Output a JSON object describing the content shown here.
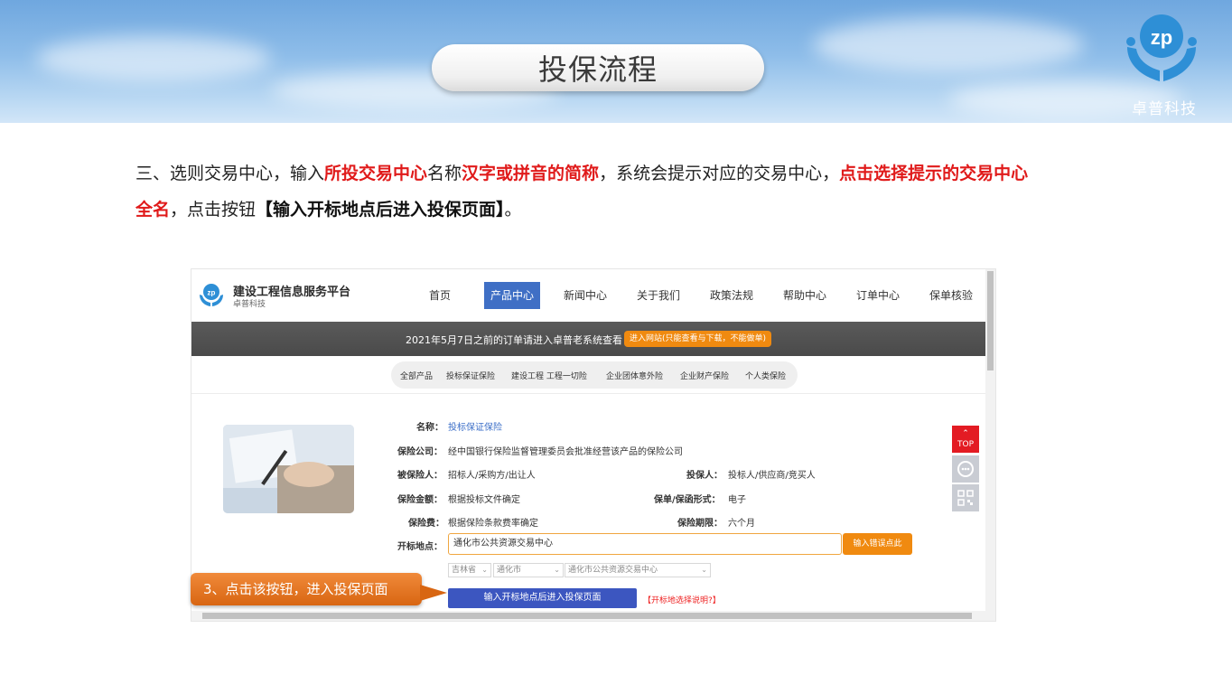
{
  "slide": {
    "title": "投保流程",
    "brand": {
      "name": "卓普科技",
      "logo_icon": "zp-hands-logo-icon",
      "color": "#2e8fd6"
    }
  },
  "instruction": {
    "p1": "三、选则交易中心，输入",
    "p2": "所投交易中心",
    "p3": "名称",
    "p4": "汉字或拼音的简称",
    "p5": "，系统会提示对应的交易中心，",
    "p6": "点击选择提示的交易中心全名",
    "p7": "，点击按钮",
    "p8": "【输入开标地点后进入投保页面】",
    "p9": "。"
  },
  "site": {
    "platform_title": "建设工程信息服务平台",
    "platform_sub": "卓普科技",
    "nav": [
      "首页",
      "产品中心",
      "新闻中心",
      "关于我们",
      "政策法规",
      "帮助中心",
      "订单中心",
      "保单核验"
    ],
    "nav_active": "产品中心",
    "notice_text": "2021年5月7日之前的订单请进入卓普老系统查看",
    "notice_button": "进入网站(只能查看与下载，不能做单)",
    "categories": [
      "全部产品",
      "投标保证保险",
      "建设工程 工程一切险",
      "企业团体意外险",
      "企业财产保险",
      "个人类保险"
    ],
    "details": {
      "name_label": "名称：",
      "name_value": "投标保证保险",
      "company_label": "保险公司：",
      "company_value": "经中国银行保险监督管理委员会批准经营该产品的保险公司",
      "insured_label": "被保险人：",
      "insured_value": "招标人/采购方/出让人",
      "applicant_label": "投保人：",
      "applicant_value": "投标人/供应商/竞买人",
      "amount_label": "保险金额：",
      "amount_value": "根据投标文件确定",
      "form_label": "保单/保函形式：",
      "form_value": "电子",
      "fee_label": "保险费：",
      "fee_value": "根据保险条款费率确定",
      "period_label": "保险期限：",
      "period_value": "六个月",
      "location_label": "开标地点：",
      "location_value": "通化市公共资源交易中心",
      "error_button": "输入错误点此"
    },
    "selects": [
      "吉林省",
      "通化市",
      "通化市公共资源交易中心"
    ],
    "enter_button": "输入开标地点后进入投保页面",
    "explain_link": "【开标地选择说明?】",
    "side_top": "TOP",
    "side_icons": [
      "top-icon",
      "customer-service-icon",
      "qr-code-icon"
    ]
  },
  "callout": {
    "text": "3、点击该按钮，进入投保页面",
    "color": "#e27420"
  }
}
